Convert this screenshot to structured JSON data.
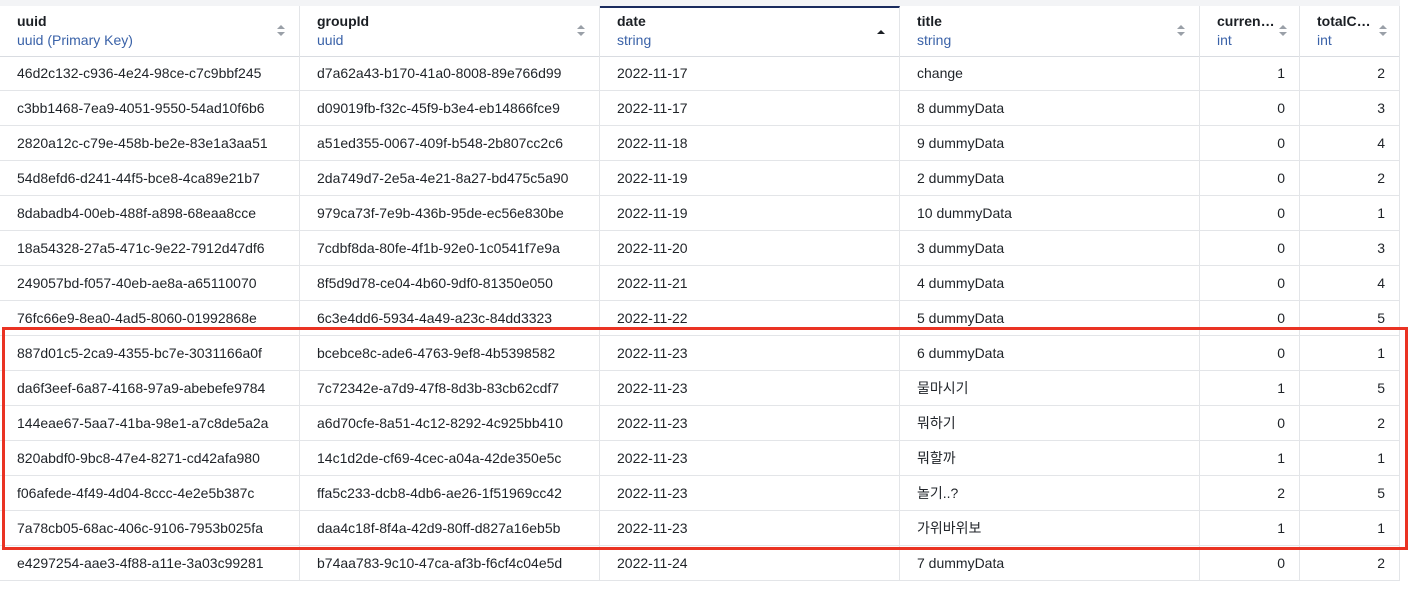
{
  "columns": [
    {
      "name": "uuid",
      "type": "uuid (Primary Key)"
    },
    {
      "name": "groupId",
      "type": "uuid"
    },
    {
      "name": "date",
      "type": "string",
      "sorted": "asc"
    },
    {
      "name": "title",
      "type": "string"
    },
    {
      "name": "curren…",
      "type": "int"
    },
    {
      "name": "totalC…",
      "type": "int"
    }
  ],
  "rows": [
    [
      "46d2c132-c936-4e24-98ce-c7c9bbf245",
      "d7a62a43-b170-41a0-8008-89e766d99",
      "2022-11-17",
      "change",
      "1",
      "2"
    ],
    [
      "c3bb1468-7ea9-4051-9550-54ad10f6b6",
      "d09019fb-f32c-45f9-b3e4-eb14866fce9",
      "2022-11-17",
      "8 dummyData",
      "0",
      "3"
    ],
    [
      "2820a12c-c79e-458b-be2e-83e1a3aa51",
      "a51ed355-0067-409f-b548-2b807cc2c6",
      "2022-11-18",
      "9 dummyData",
      "0",
      "4"
    ],
    [
      "54d8efd6-d241-44f5-bce8-4ca89e21b7",
      "2da749d7-2e5a-4e21-8a27-bd475c5a90",
      "2022-11-19",
      "2 dummyData",
      "0",
      "2"
    ],
    [
      "8dabadb4-00eb-488f-a898-68eaa8cce",
      "979ca73f-7e9b-436b-95de-ec56e830be",
      "2022-11-19",
      "10 dummyData",
      "0",
      "1"
    ],
    [
      "18a54328-27a5-471c-9e22-7912d47df6",
      "7cdbf8da-80fe-4f1b-92e0-1c0541f7e9a",
      "2022-11-20",
      "3 dummyData",
      "0",
      "3"
    ],
    [
      "249057bd-f057-40eb-ae8a-a65110070",
      "8f5d9d78-ce04-4b60-9df0-81350e050",
      "2022-11-21",
      "4 dummyData",
      "0",
      "4"
    ],
    [
      "76fc66e9-8ea0-4ad5-8060-01992868e",
      "6c3e4dd6-5934-4a49-a23c-84dd3323",
      "2022-11-22",
      "5 dummyData",
      "0",
      "5"
    ],
    [
      "887d01c5-2ca9-4355-bc7e-3031166a0f",
      "bcebce8c-ade6-4763-9ef8-4b5398582",
      "2022-11-23",
      "6 dummyData",
      "0",
      "1"
    ],
    [
      "da6f3eef-6a87-4168-97a9-abebefe9784",
      "7c72342e-a7d9-47f8-8d3b-83cb62cdf7",
      "2022-11-23",
      "물마시기",
      "1",
      "5"
    ],
    [
      "144eae67-5aa7-41ba-98e1-a7c8de5a2a",
      "a6d70cfe-8a51-4c12-8292-4c925bb410",
      "2022-11-23",
      "뭐하기",
      "0",
      "2"
    ],
    [
      "820abdf0-9bc8-47e4-8271-cd42afa980",
      "14c1d2de-cf69-4cec-a04a-42de350e5c",
      "2022-11-23",
      "뭐할까",
      "1",
      "1"
    ],
    [
      "f06afede-4f49-4d04-8ccc-4e2e5b387c",
      "ffa5c233-dcb8-4db6-ae26-1f51969cc42",
      "2022-11-23",
      "놀기..?",
      "2",
      "5"
    ],
    [
      "7a78cb05-68ac-406c-9106-7953b025fa",
      "daa4c18f-8f4a-42d9-80ff-d827a16eb5b",
      "2022-11-23",
      "가위바위보",
      "1",
      "1"
    ],
    [
      "e4297254-aae3-4f88-a11e-3a03c99281",
      "b74aa783-9c10-47ca-af3b-f6cf4c04e5d",
      "2022-11-24",
      "7 dummyData",
      "0",
      "2"
    ]
  ],
  "colors": {
    "accent": "#3a62a8",
    "highlight": "#ea3323",
    "sorted_header": "#1a2b5e"
  },
  "icons": {
    "sort": "sort-arrows-icon",
    "sort_asc": "sort-ascending-icon"
  }
}
